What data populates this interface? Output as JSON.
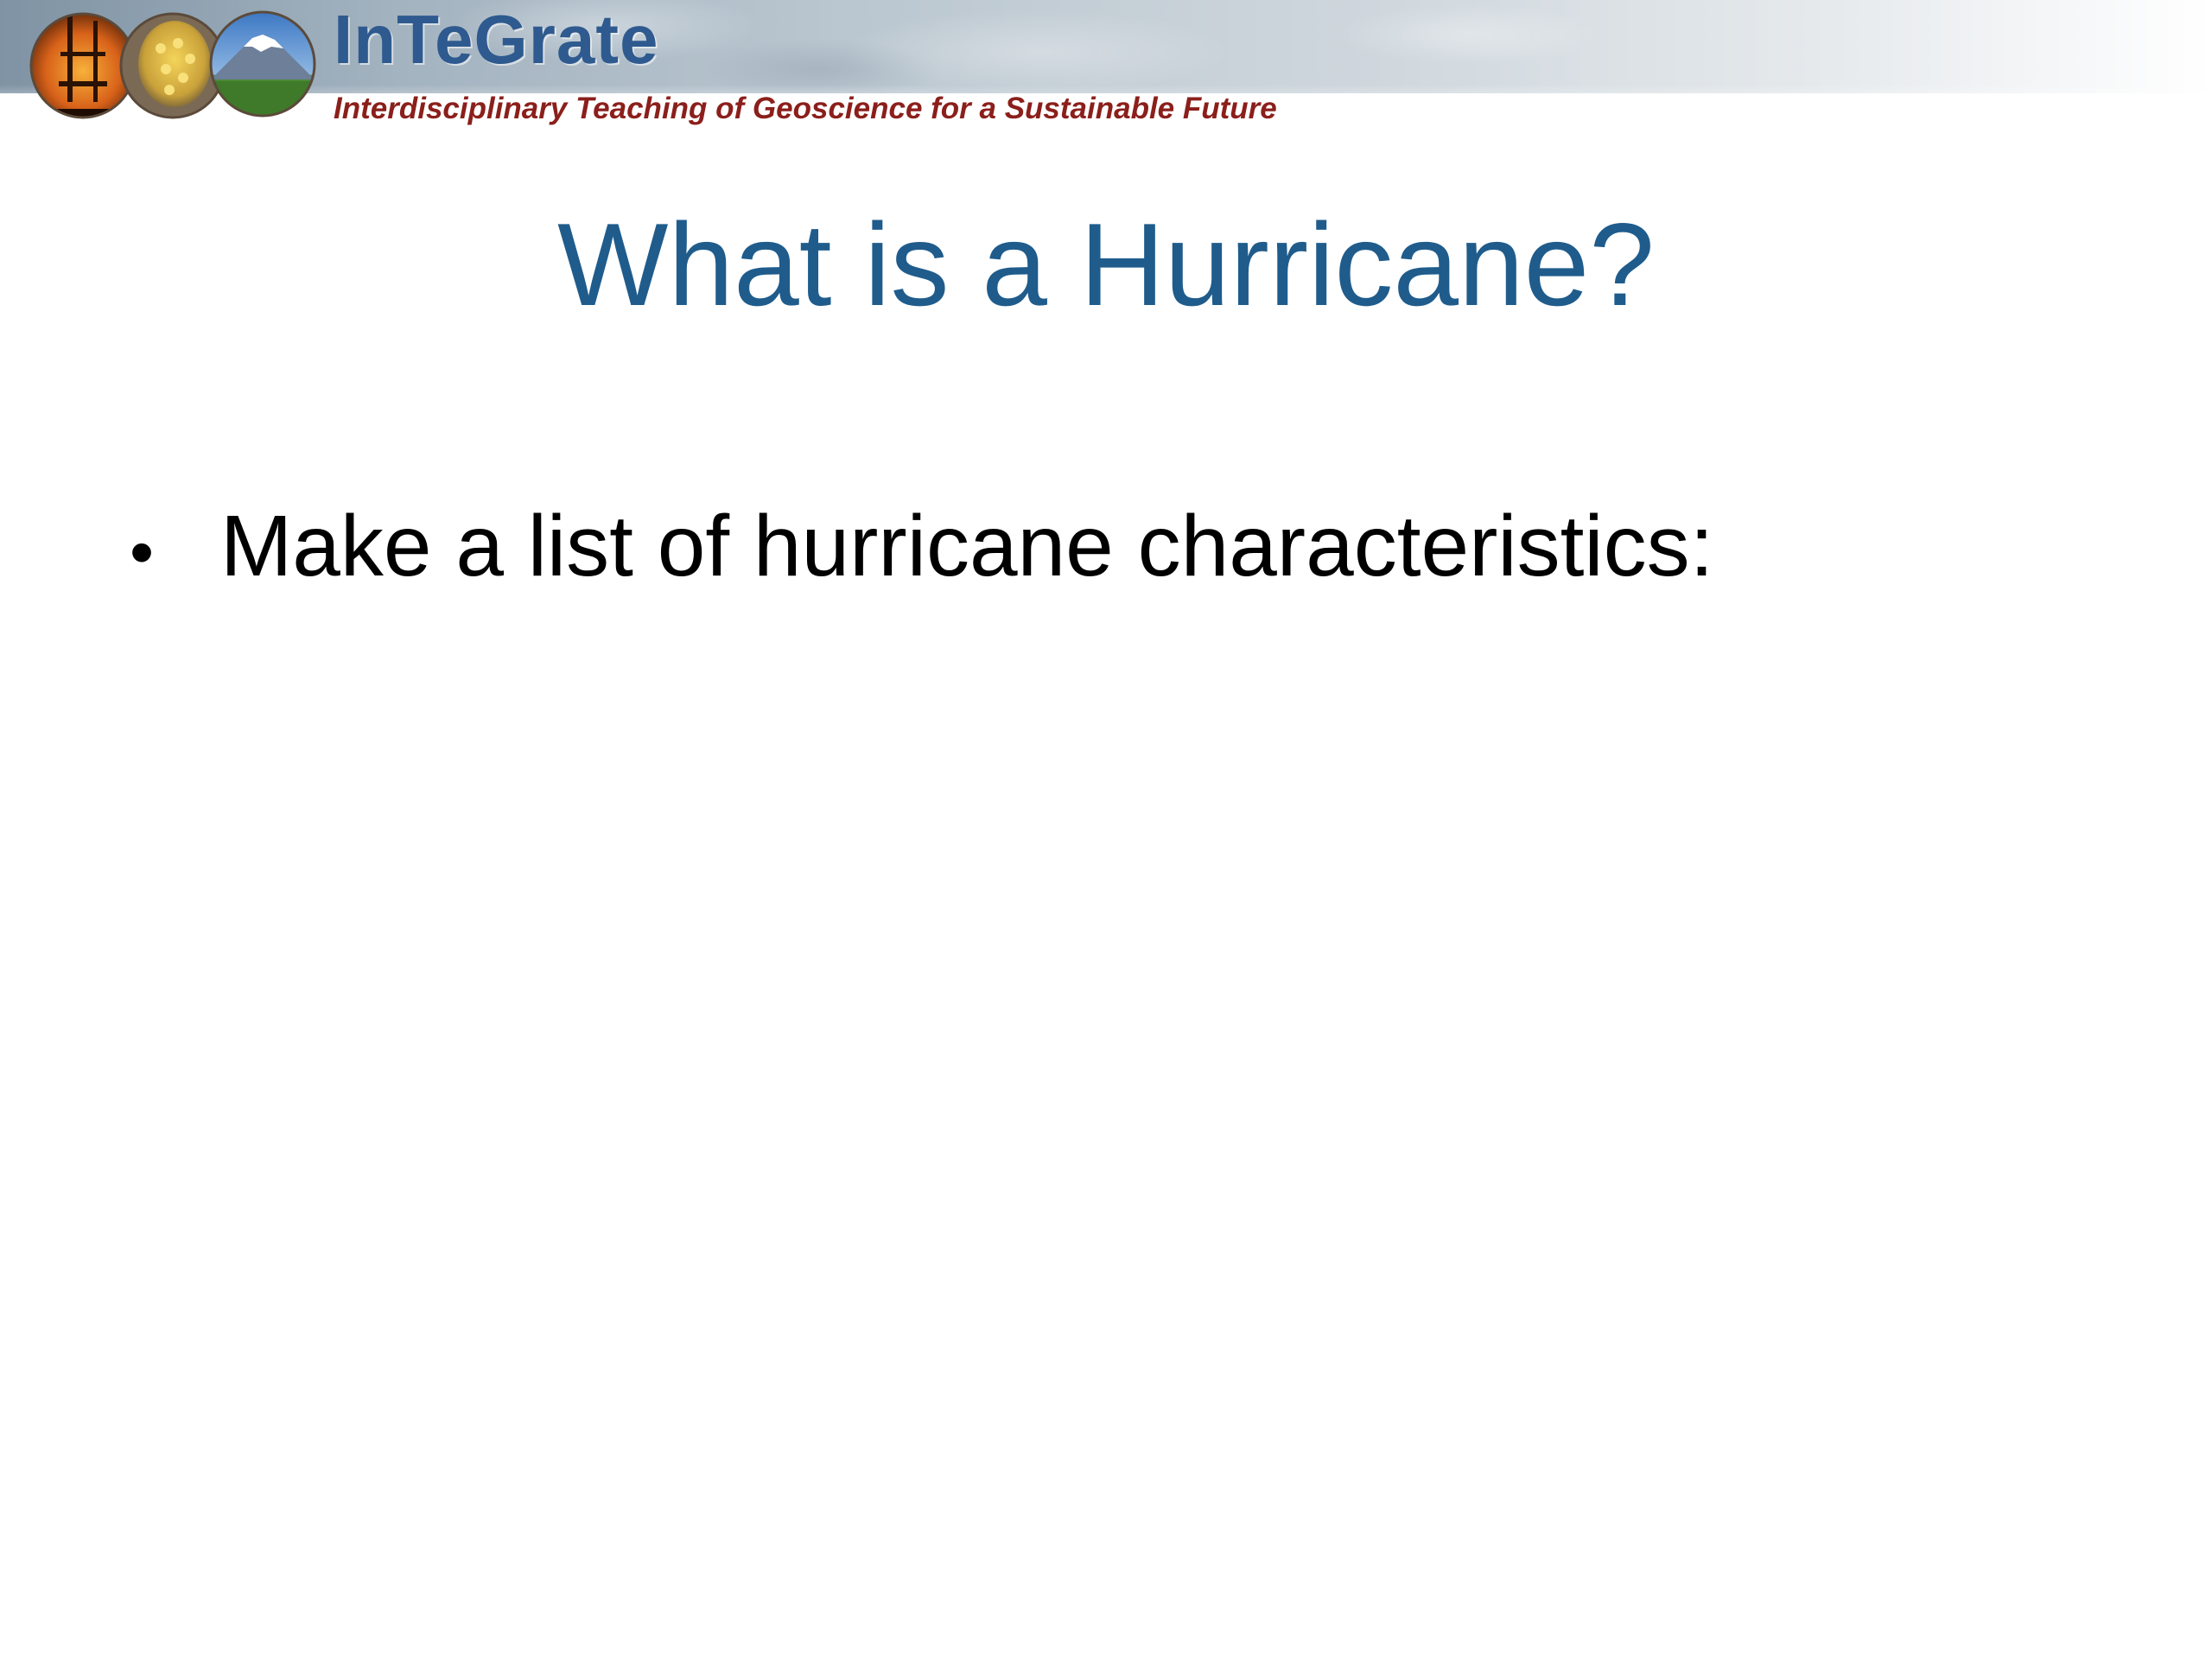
{
  "header": {
    "brand_name": "InTeGrate",
    "tagline": "Interdisciplinary Teaching of Geoscience for a Sustainable Future",
    "logo_images": [
      "oil-rig-photo",
      "corn-kernels-photo",
      "volcano-landscape-photo"
    ]
  },
  "slide": {
    "title": "What is a Hurricane?",
    "bullets": [
      {
        "marker": "•",
        "text": "Make a list of hurricane characteristics:"
      }
    ]
  },
  "colors": {
    "title": "#1f5c8c",
    "brand_name": "#2e5a8f",
    "tagline": "#8b1f1b",
    "body_text": "#000000"
  }
}
